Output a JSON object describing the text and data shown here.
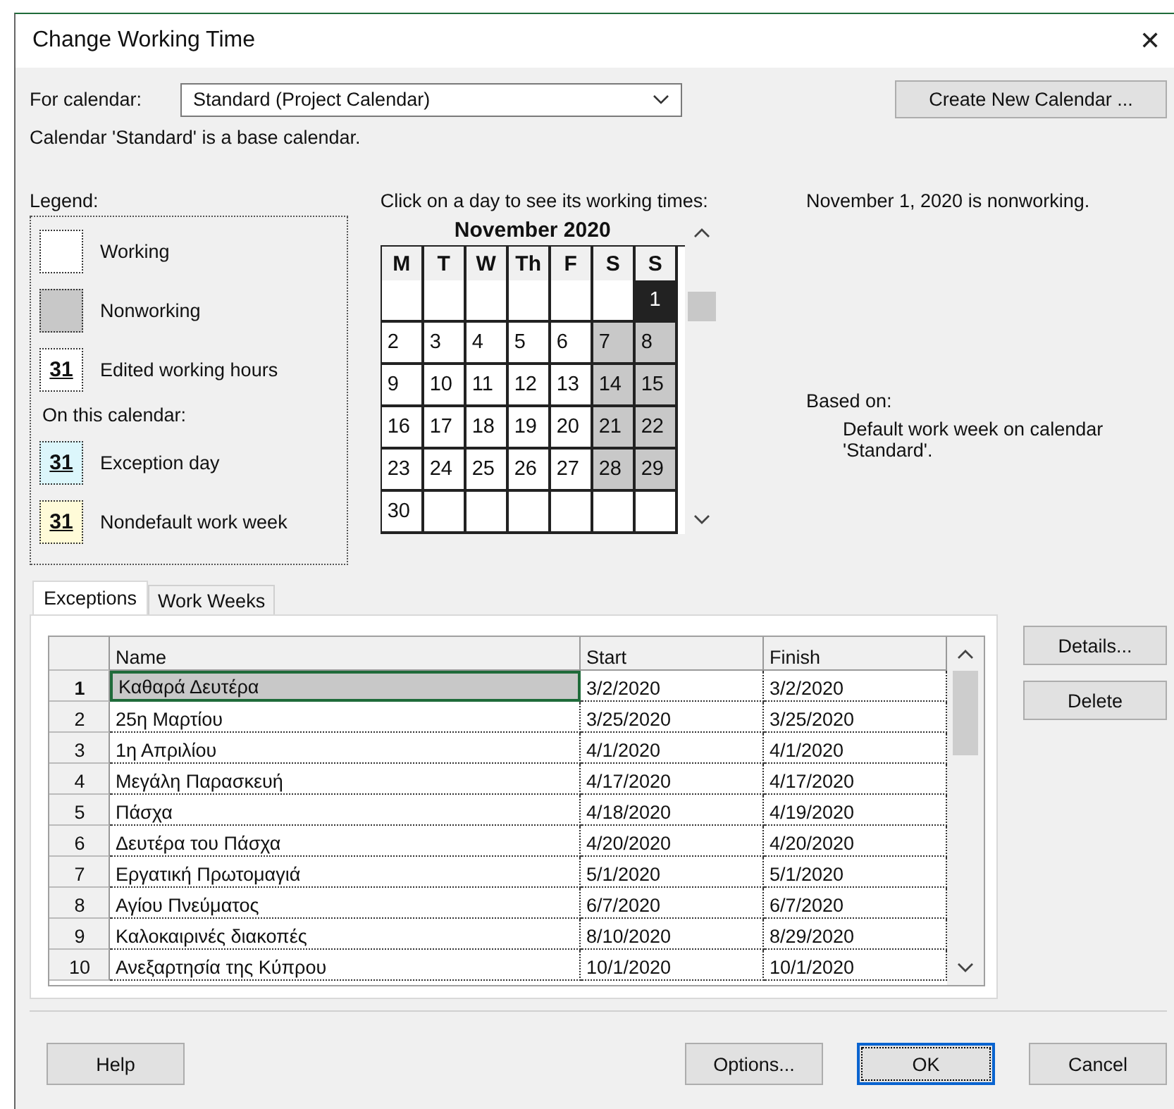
{
  "window": {
    "title": "Change Working Time",
    "close": "✕"
  },
  "for_calendar": {
    "label": "For calendar:",
    "value": "Standard (Project Calendar)"
  },
  "create_button": "Create New Calendar ...",
  "base_note": "Calendar 'Standard' is a base calendar.",
  "legend": {
    "title": "Legend:",
    "items": [
      {
        "kind": "working",
        "label": "Working"
      },
      {
        "kind": "nonworking",
        "label": "Nonworking"
      },
      {
        "kind": "edited",
        "label": "Edited working hours",
        "swatch_text": "31"
      }
    ],
    "subheading": "On this calendar:",
    "calendar_items": [
      {
        "kind": "exception",
        "label": "Exception day",
        "swatch_text": "31"
      },
      {
        "kind": "nondefault",
        "label": "Nondefault work week",
        "swatch_text": "31"
      }
    ]
  },
  "calendar": {
    "prompt": "Click on a day to see its working times:",
    "month": "November 2020",
    "weekdays": [
      "M",
      "T",
      "W",
      "Th",
      "F",
      "S",
      "S"
    ],
    "weeks": [
      [
        {
          "kind": "blank"
        },
        {
          "kind": "blank"
        },
        {
          "kind": "blank"
        },
        {
          "kind": "blank"
        },
        {
          "kind": "blank"
        },
        {
          "kind": "blank"
        },
        {
          "kind": "day",
          "day": "1",
          "selected": true
        }
      ],
      [
        {
          "day": "2",
          "nonworking": false,
          "selected": false
        },
        {
          "day": "3",
          "nonworking": false,
          "selected": false
        },
        {
          "day": "4",
          "nonworking": false,
          "selected": false
        },
        {
          "day": "5",
          "nonworking": false,
          "selected": false
        },
        {
          "day": "6",
          "nonworking": false,
          "selected": false
        },
        {
          "day": "7",
          "nonworking": true,
          "selected": false
        },
        {
          "day": "8",
          "nonworking": true,
          "selected": false
        }
      ],
      [
        {
          "day": "9",
          "nonworking": false,
          "selected": false
        },
        {
          "day": "10",
          "nonworking": false,
          "selected": false
        },
        {
          "day": "11",
          "nonworking": false,
          "selected": false
        },
        {
          "day": "12",
          "nonworking": false,
          "selected": false
        },
        {
          "day": "13",
          "nonworking": false,
          "selected": false
        },
        {
          "day": "14",
          "nonworking": true,
          "selected": false
        },
        {
          "day": "15",
          "nonworking": true,
          "selected": false
        }
      ],
      [
        {
          "day": "16",
          "nonworking": false,
          "selected": false
        },
        {
          "day": "17",
          "nonworking": false,
          "selected": false
        },
        {
          "day": "18",
          "nonworking": false,
          "selected": false
        },
        {
          "day": "19",
          "nonworking": false,
          "selected": false
        },
        {
          "day": "20",
          "nonworking": false,
          "selected": false
        },
        {
          "day": "21",
          "nonworking": true,
          "selected": false
        },
        {
          "day": "22",
          "nonworking": true,
          "selected": false
        }
      ],
      [
        {
          "day": "23",
          "nonworking": false,
          "selected": false
        },
        {
          "day": "24",
          "nonworking": false,
          "selected": false
        },
        {
          "day": "25",
          "nonworking": false,
          "selected": false
        },
        {
          "day": "26",
          "nonworking": false,
          "selected": false
        },
        {
          "day": "27",
          "nonworking": false,
          "selected": false
        },
        {
          "day": "28",
          "nonworking": true,
          "selected": false
        },
        {
          "day": "29",
          "nonworking": true,
          "selected": false
        }
      ],
      [
        {
          "day": "30",
          "nonworking": false,
          "selected": false
        },
        {
          "kind": "blank"
        },
        {
          "kind": "blank"
        },
        {
          "kind": "blank"
        },
        {
          "kind": "blank"
        },
        {
          "kind": "blank"
        },
        {
          "kind": "blank"
        }
      ]
    ]
  },
  "day_status": "November 1, 2020 is nonworking.",
  "based_on": {
    "label": "Based on:",
    "detail": "Default work week on calendar 'Standard'."
  },
  "tabs": [
    {
      "label": "Exceptions",
      "selected": true
    },
    {
      "label": "Work Weeks",
      "selected": false
    }
  ],
  "table": {
    "columns": [
      "Name",
      "Start",
      "Finish"
    ],
    "rows": [
      {
        "number": "1",
        "name": "Καθαρά Δευτέρα",
        "start": "3/2/2020",
        "finish": "3/2/2020",
        "selected": true
      },
      {
        "number": "2",
        "name": "25η Μαρτίου",
        "start": "3/25/2020",
        "finish": "3/25/2020",
        "selected": false
      },
      {
        "number": "3",
        "name": "1η Απριλίου",
        "start": "4/1/2020",
        "finish": "4/1/2020",
        "selected": false
      },
      {
        "number": "4",
        "name": "Μεγάλη Παρασκευή",
        "start": "4/17/2020",
        "finish": "4/17/2020",
        "selected": false
      },
      {
        "number": "5",
        "name": "Πάσχα",
        "start": "4/18/2020",
        "finish": "4/19/2020",
        "selected": false
      },
      {
        "number": "6",
        "name": "Δευτέρα του Πάσχα",
        "start": "4/20/2020",
        "finish": "4/20/2020",
        "selected": false
      },
      {
        "number": "7",
        "name": "Εργατική Πρωτομαγιά",
        "start": "5/1/2020",
        "finish": "5/1/2020",
        "selected": false
      },
      {
        "number": "8",
        "name": "Αγίου Πνεύματος",
        "start": "6/7/2020",
        "finish": "6/7/2020",
        "selected": false
      },
      {
        "number": "9",
        "name": "Καλοκαιρινές διακοπές",
        "start": "8/10/2020",
        "finish": "8/29/2020",
        "selected": false
      },
      {
        "number": "10",
        "name": "Ανεξαρτησία της Κύπρου",
        "start": "10/1/2020",
        "finish": "10/1/2020",
        "selected": false
      }
    ]
  },
  "side_buttons": [
    "Details...",
    "Delete"
  ],
  "footer_buttons": [
    {
      "label": "Help",
      "focused": false
    },
    {
      "label": "Options...",
      "focused": false
    },
    {
      "label": "OK",
      "focused": true
    },
    {
      "label": "Cancel",
      "focused": false
    }
  ]
}
